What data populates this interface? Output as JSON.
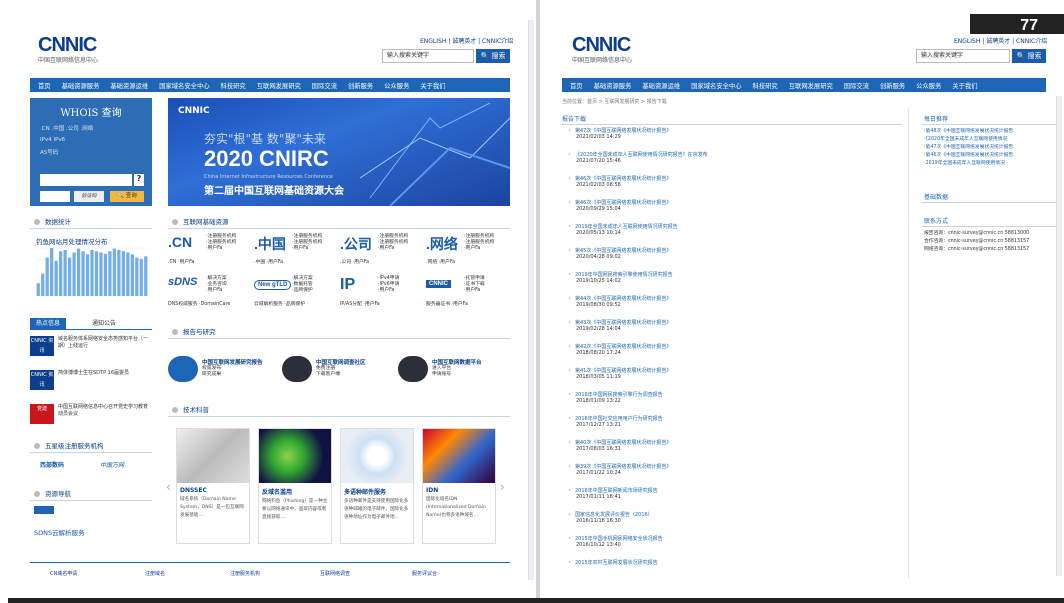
{
  "page_number": "77",
  "left": {
    "logo": "CNNIC",
    "logo_sub": "中国互联网络信息中心",
    "toplinks": "ENGLISH | 诚聘英才 | CNNIC介绍",
    "search_placeholder": "输入搜索关键字",
    "search_button": "搜索",
    "nav": [
      "首页",
      "基础资源服务",
      "基础资源运维",
      "国家域名安全中心",
      "科技研究",
      "互联网发展研究",
      "国际交流",
      "创新服务",
      "公众服务",
      "关于我们"
    ],
    "whois": {
      "title": "WHOIS 查询",
      "row1": ".CN   .中国   .公司   .网络",
      "row2": "IPv4        IPv6",
      "row3": "AS号码",
      "captcha": "验证码",
      "query_button": "查询",
      "help": "?"
    },
    "banner": {
      "logo": "CNNIC",
      "slogan": "夯实\"根\"基  数\"聚\"未来",
      "year": "2020 CNIRC",
      "sub": "China Internet Infrastructure Resources Conference",
      "name": "第二届中国互联网基础资源大会"
    },
    "sec_stats": "数据统计",
    "chart_title": "钓鱼网站月处理情况分布",
    "chart_data": {
      "type": "bar",
      "title": "钓鱼网站月处理情况分布",
      "values": [
        20,
        35,
        60,
        75,
        55,
        70,
        72,
        60,
        68,
        74,
        70,
        65,
        72,
        70,
        68,
        66,
        70,
        74,
        72,
        70,
        68,
        65,
        60,
        58,
        62
      ]
    },
    "tabs": [
      "热点信息",
      "通知公告"
    ],
    "news": [
      {
        "thumb": "CNNIC 资讯",
        "text": "域名服务体系网络安全态势感知平台（一期）上线运行"
      },
      {
        "thumb": "CNNIC 资讯",
        "text": "简体博博士生在SDTP 16届委员"
      },
      {
        "thumb": "党建",
        "text": "中国互联网络信息中心召开党史学习教育动员会议"
      }
    ],
    "sec_partners": "五星级注册服务机构",
    "partners": [
      "西部数码",
      "中国万网"
    ],
    "sec_resources": "资源导航",
    "sdns": "SDNS云解析服务",
    "sec_resource_services": "互联网基础资源",
    "resources": [
      {
        "name": ".CN",
        "links": [
          "·注册服务机构",
          "·注册服务机构",
          "·用户Fa"
        ],
        "sub": ".CN      ·用户Fa"
      },
      {
        "name": ".中国",
        "links": [
          "·注册服务机构",
          "·注册服务机构",
          "·用户Fa"
        ],
        "sub": ".中国    ·用户Fa"
      },
      {
        "name": ".公司",
        "links": [
          "·注册服务机构",
          "·注册服务机构",
          "·用户Fa"
        ],
        "sub": ".公司    ·用户Fa"
      },
      {
        "name": ".网络",
        "links": [
          "·注册服务机构",
          "·注册服务机构",
          "·用户Fa"
        ],
        "sub": ".网络    ·用户Fa"
      },
      {
        "name": "sDNS",
        "links": [
          "·解决方案",
          "·业务咨询",
          "·用户Fa"
        ],
        "sub": "DNS权威服务 ·DomainCare"
      },
      {
        "name": "New gTLD",
        "links": [
          "·解决方案",
          "·数据托管",
          "·品牌保护"
        ],
        "sub": "云域解析服务 ·品牌保护"
      },
      {
        "name": "IP",
        "links": [
          "·IPv4申请",
          "·IPv6申请",
          "·用户Fa"
        ],
        "sub": "IP/AS分配  ·用户Fa"
      },
      {
        "name": "CNNIC",
        "links": [
          "·托管申请",
          "·证书下载",
          "·用户Fa"
        ],
        "sub": "服务器证书 ·用户Fa"
      }
    ],
    "sec_reports": "报告与研究",
    "reports": [
      {
        "title": "中国互联网发展研究报告",
        "links": [
          "权威发布",
          "研究成果"
        ]
      },
      {
        "title": "中国互联网调查社区",
        "links": [
          "免费注册",
          "下载客户端"
        ]
      },
      {
        "title": "中国互联网数据平台",
        "links": [
          "进入平台",
          "申请账号"
        ]
      }
    ],
    "sec_tech": "技术科普",
    "cards": [
      {
        "title": "DNSSEC",
        "desc": "域名系统（Domain Name System，DNS）是一包互联网发展基础...."
      },
      {
        "title": "反域名滥用",
        "desc": "网络钓鱼（Phishing）是一种主要以网络通讯中，盗取内容或者直接获取...."
      },
      {
        "title": "多语种邮件服务",
        "desc": "多语种邮件是支持使用国际化多语种邮箱的电子邮件，国际化多语种地址作为电子邮件地..."
      },
      {
        "title": "IDN",
        "desc": "国际化域名IDN (Internationalized Domain Name)也称多语种域名...."
      }
    ],
    "footer": [
      "CN域名申请",
      "注册域名",
      "注册服务机构",
      "互联网络调查",
      "服务评议合"
    ]
  },
  "right": {
    "logo": "CNNIC",
    "logo_sub": "中国互联网络信息中心",
    "toplinks": "ENGLISH | 诚聘英才 | CNNIC介绍",
    "search_placeholder": "输入搜索关键字",
    "search_button": "搜索",
    "nav": [
      "首页",
      "基础资源服务",
      "基础资源运维",
      "国家域名安全中心",
      "科技研究",
      "互联网发展研究",
      "国际交流",
      "创新服务",
      "公众服务",
      "关于我们"
    ],
    "breadcrumb": "当前位置：首页 > 互联网发展研究 > 报告下载",
    "list_title": "报告下载",
    "reports": [
      {
        "title": "第47次《中国互联网络发展状况统计报告》",
        "date": "2021/02/03 14:29"
      },
      {
        "title": "《2020年全国未成年人互联网使用情况研究报告》在京发布",
        "date": "2021/07/20 15:46"
      },
      {
        "title": "第46次《中国互联网络发展状况统计报告》",
        "date": "2021/02/03 08:58"
      },
      {
        "title": "第46次《中国互联网络发展状况统计报告》",
        "date": "2020/09/29 15:04"
      },
      {
        "title": "2019年全国未成年人互联网使用情况研究报告",
        "date": "2020/05/13 10:14"
      },
      {
        "title": "第45次《中国互联网络发展状况统计报告》",
        "date": "2020/04/28 09:02"
      },
      {
        "title": "2019年中国网民搜索引擎使用情况研究报告",
        "date": "2019/10/25 14:02"
      },
      {
        "title": "第44次《中国互联网络发展状况统计报告》",
        "date": "2019/08/30 09:52"
      },
      {
        "title": "第43次《中国互联网络发展状况统计报告》",
        "date": "2019/02/28 14:04"
      },
      {
        "title": "第42次《中国互联网络发展状况统计报告》",
        "date": "2018/08/20 17:24"
      },
      {
        "title": "第41次《中国互联网络发展状况统计报告》",
        "date": "2018/03/05 11:19"
      },
      {
        "title": "2016年中国网民搜索引擎行为调查报告",
        "date": "2018/01/09 13:22"
      },
      {
        "title": "2016年中国社交应用用户行为研究报告",
        "date": "2017/12/27 13:21"
      },
      {
        "title": "第40次《中国互联网络发展状况统计报告》",
        "date": "2017/08/03 16:31"
      },
      {
        "title": "第39次《中国互联网络发展状况统计报告》",
        "date": "2017/01/22 10:24"
      },
      {
        "title": "2016年中国互联网新闻市场研究报告",
        "date": "2017/01/11 18:41"
      },
      {
        "title": "国家信息化发展评价报告（2016）",
        "date": "2016/11/18 16:30"
      },
      {
        "title": "2015年中国手机网民网络安全状况报告",
        "date": "2016/10/12 13:40"
      },
      {
        "title": "2015年农村互联网发展状况研究报告",
        "date": ""
      }
    ],
    "side_title_1": "每日推荐",
    "side_items": [
      "·第48次《中国互联网络发展状况统计报告",
      "·《2020年全国未成年人互联网使用情况",
      "·第47次《中国互联网络发展状况统计报告",
      "·第46次《中国互联网络发展状况统计报告",
      "·2019年全国未成年人互联网使用情况"
    ],
    "side_title_2": "基础数据",
    "side_title_3": "联系方式",
    "contact": [
      "报告咨询：cnnic-survey@cnnic.cn  58813000",
      "合作咨询：cnnic-survey@cnnic.cn  58813157",
      "网络咨询：cnnic-survey@cnnic.cn  58813157"
    ]
  }
}
